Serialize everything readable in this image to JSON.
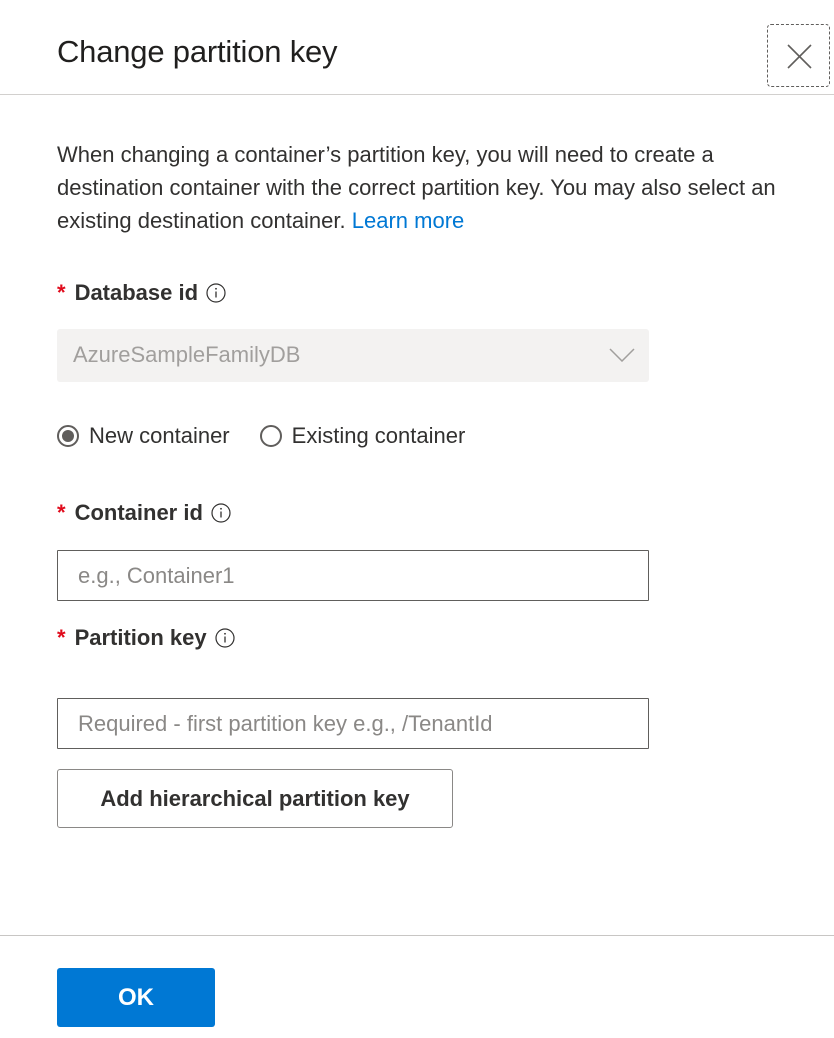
{
  "dialog": {
    "title": "Change partition key",
    "close_icon": "close-icon"
  },
  "description": {
    "text": "When changing a container’s partition key, you will need to create a destination container with the correct partition key. You may also select an existing destination container. ",
    "link_label": "Learn more",
    "link_color": "#0078d4"
  },
  "fields": {
    "database": {
      "required_marker": "*",
      "label": "Database id",
      "info_icon": "info-icon",
      "value": "AzureSampleFamilyDB",
      "disabled": true,
      "chevron_icon": "chevron-down-icon"
    },
    "container_mode": {
      "options": [
        {
          "label": "New container",
          "checked": true
        },
        {
          "label": "Existing container",
          "checked": false
        }
      ]
    },
    "container_id": {
      "required_marker": "*",
      "label": "Container id",
      "info_icon": "info-icon",
      "value": "",
      "placeholder": "e.g., Container1"
    },
    "partition_key": {
      "required_marker": "*",
      "label": "Partition key",
      "info_icon": "info-icon",
      "value": "",
      "placeholder": "Required - first partition key e.g., /TenantId"
    }
  },
  "buttons": {
    "add_hierarchical": "Add hierarchical partition key",
    "ok": "OK"
  },
  "colors": {
    "primary": "#0078d4",
    "required": "#e00b1c",
    "disabled_bg": "#f3f2f1"
  }
}
